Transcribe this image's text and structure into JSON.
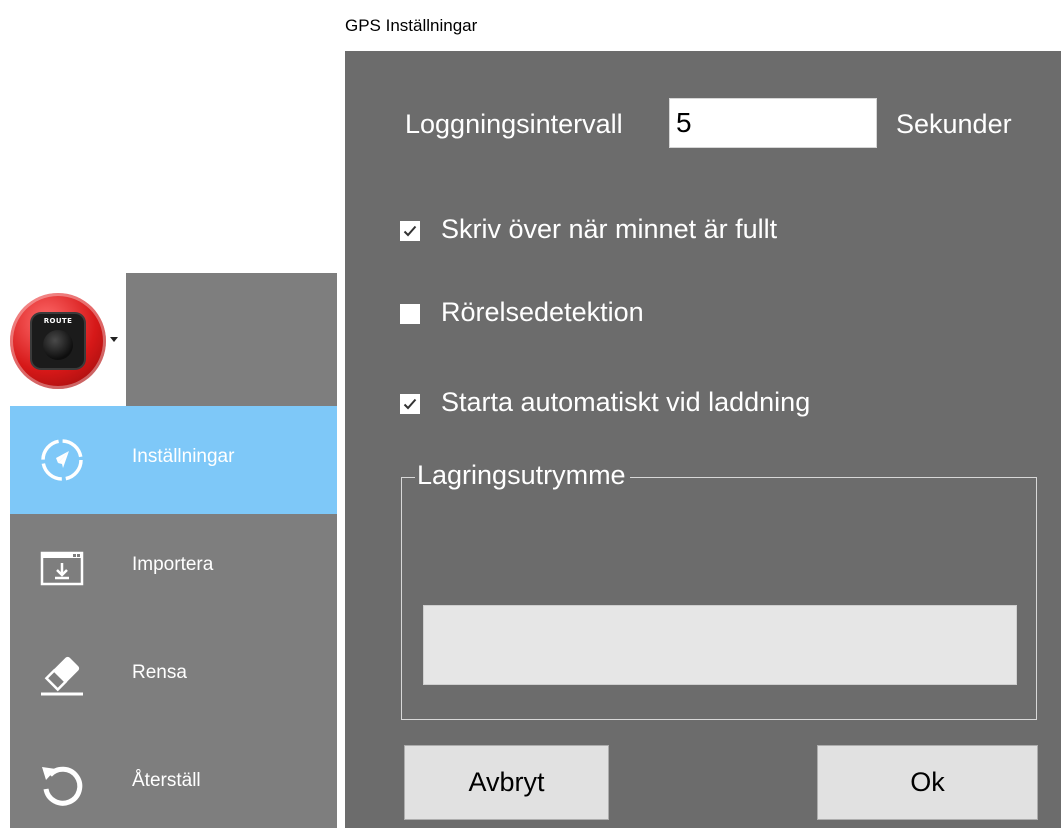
{
  "sidebar": {
    "logo": {
      "text": "ROUTE",
      "icon": "route-logo-icon"
    },
    "items": [
      {
        "label": "Inställningar",
        "icon": "compass-icon",
        "active": true
      },
      {
        "label": "Importera",
        "icon": "import-window-icon",
        "active": false
      },
      {
        "label": "Rensa",
        "icon": "eraser-icon",
        "active": false
      },
      {
        "label": "Återställ",
        "icon": "reset-arrow-icon",
        "active": false
      }
    ]
  },
  "dialog": {
    "title": "GPS Inställningar",
    "interval": {
      "label": "Loggningsintervall",
      "value": "5",
      "unit": "Sekunder"
    },
    "options": [
      {
        "label": "Skriv över när minnet är fullt",
        "checked": true
      },
      {
        "label": "Rörelsedetektion",
        "checked": false
      },
      {
        "label": "Starta automatiskt vid laddning",
        "checked": true
      }
    ],
    "storage": {
      "label": "Lagringsutrymme"
    },
    "buttons": {
      "cancel": "Avbryt",
      "ok": "Ok"
    }
  },
  "colors": {
    "sidebar_bg": "#7e7e7e",
    "active_item": "#7ec8f8",
    "dialog_bg": "#6c6c6c",
    "button_bg": "#e1e1e1",
    "logo_red": "#d61818"
  }
}
